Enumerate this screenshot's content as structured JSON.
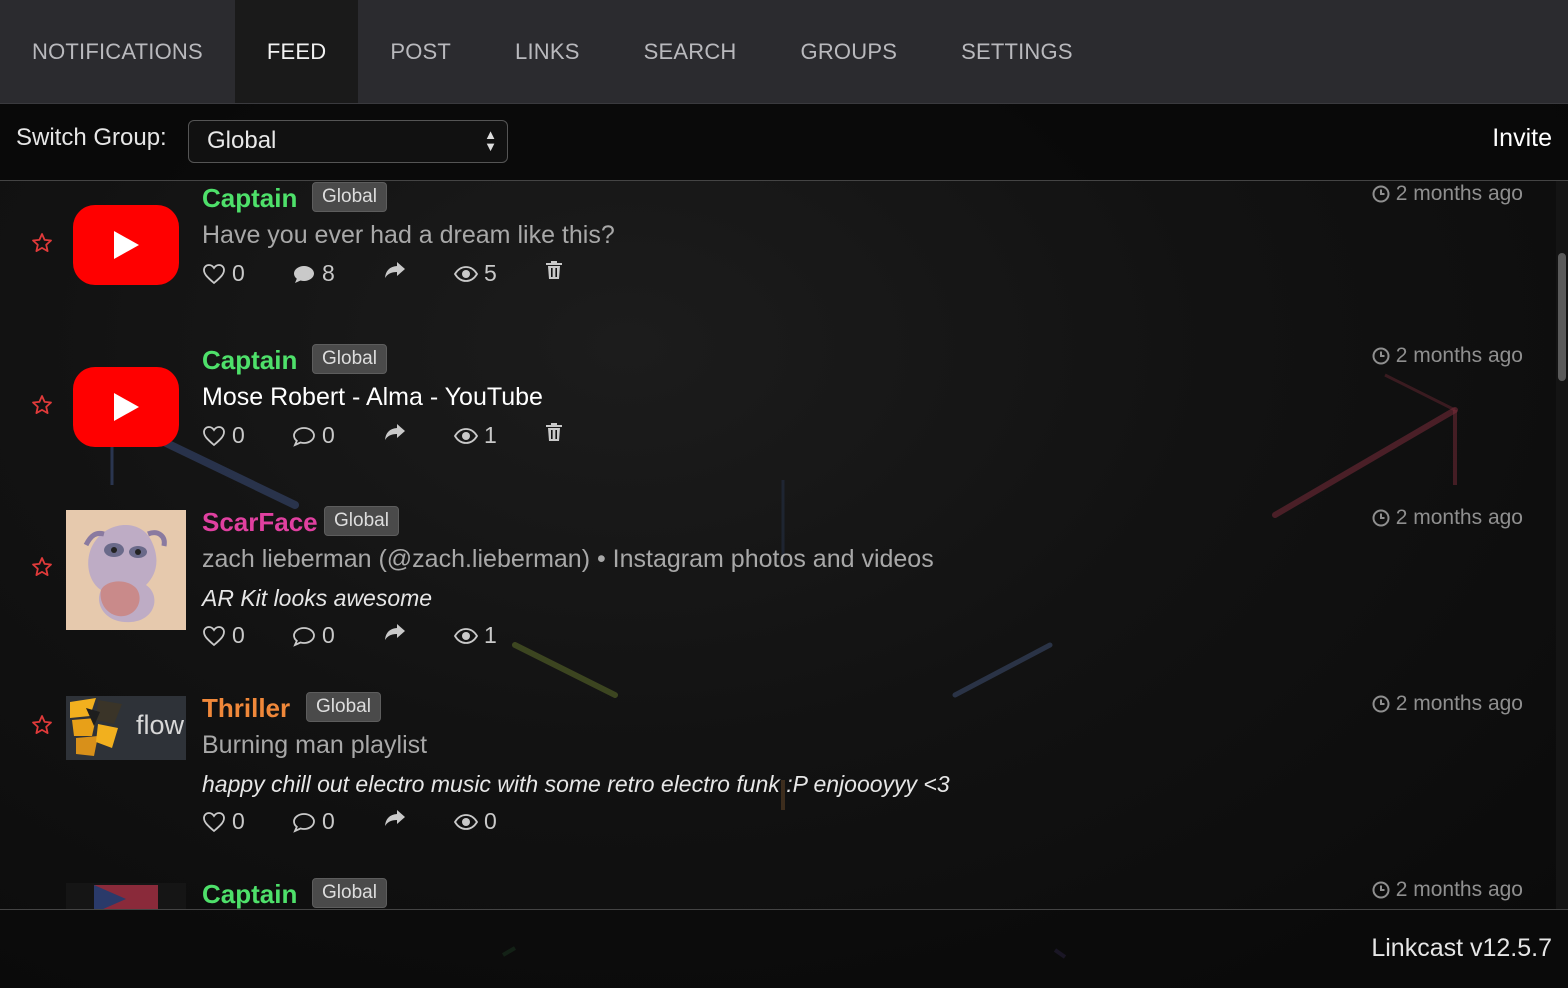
{
  "nav": {
    "tabs": [
      "NOTIFICATIONS",
      "FEED",
      "POST",
      "LINKS",
      "SEARCH",
      "GROUPS",
      "SETTINGS"
    ],
    "active": "FEED"
  },
  "groupbar": {
    "label": "Switch Group:",
    "selected": "Global",
    "invite": "Invite"
  },
  "posts": [
    {
      "author": "Captain",
      "author_color": "#4ee06a",
      "group": "Global",
      "title": "Have you ever had a dream like this?",
      "time": "2 months ago",
      "likes": "0",
      "comments": "8",
      "views": "5",
      "thumb": "youtube-logo"
    },
    {
      "author": "Captain",
      "author_color": "#4ee06a",
      "group": "Global",
      "title": "Mose Robert - Alma - YouTube",
      "time": "2 months ago",
      "likes": "0",
      "comments": "0",
      "views": "1",
      "thumb": "youtube-logo"
    },
    {
      "author": "ScarFace",
      "author_color": "#e040a0",
      "group": "Global",
      "title": "zach lieberman (@zach.lieberman) • Instagram photos and videos",
      "description": "AR Kit looks awesome",
      "time": "2 months ago",
      "likes": "0",
      "comments": "0",
      "views": "1",
      "thumb": "abstract-face"
    },
    {
      "author": "Thriller",
      "author_color": "#f0883a",
      "group": "Global",
      "title": "Burning man playlist",
      "description": "happy chill out electro music with some retro electro funk :P enjoooyyy <3",
      "time": "2 months ago",
      "likes": "0",
      "comments": "0",
      "views": "0",
      "thumb": "flow-logo",
      "thumb_text": "flow"
    },
    {
      "author": "Captain",
      "author_color": "#4ee06a",
      "group": "Global",
      "time": "2 months ago"
    }
  ],
  "footer": {
    "version": "Linkcast v12.5.7"
  },
  "colors": {
    "star": "#e03a3a",
    "nav_bg": "#2b2b2f",
    "badge_bg": "#4a4a4a"
  }
}
